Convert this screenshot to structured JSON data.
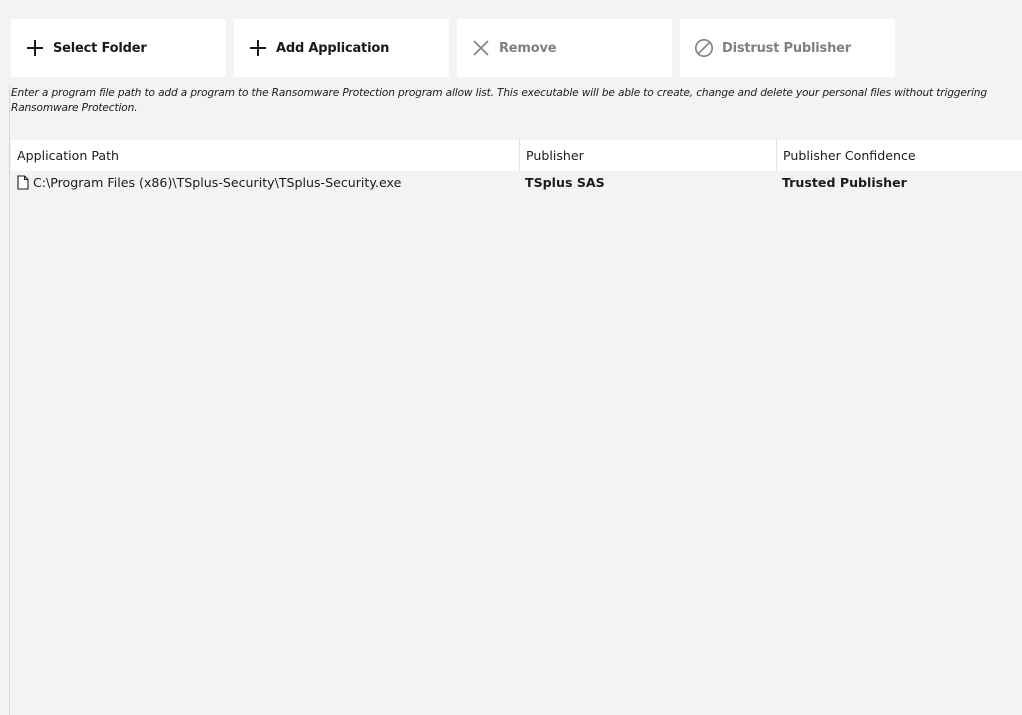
{
  "toolbar": {
    "select_folder": {
      "label": "Select Folder",
      "icon": "plus-icon",
      "enabled": true
    },
    "add_application": {
      "label": "Add Application",
      "icon": "plus-icon",
      "enabled": true
    },
    "remove": {
      "label": "Remove",
      "icon": "close-icon",
      "enabled": false
    },
    "distrust_publisher": {
      "label": "Distrust Publisher",
      "icon": "prohibited-icon",
      "enabled": false
    }
  },
  "hint": "Enter a program file path to add a program to the Ransomware Protection program allow list. This executable will be able to create, change and delete your personal files without triggering Ransomware Protection.",
  "table": {
    "columns": [
      "Application Path",
      "Publisher",
      "Publisher Confidence"
    ],
    "rows": [
      {
        "icon": "file-icon",
        "path": "C:\\Program Files (x86)\\TSplus-Security\\TSplus-Security.exe",
        "publisher": "TSplus SAS",
        "confidence": "Trusted Publisher"
      }
    ]
  },
  "colors": {
    "background": "#f3f3f3",
    "button_bg": "#ffffff",
    "disabled_text": "#808080",
    "text": "#1b1b1b"
  }
}
